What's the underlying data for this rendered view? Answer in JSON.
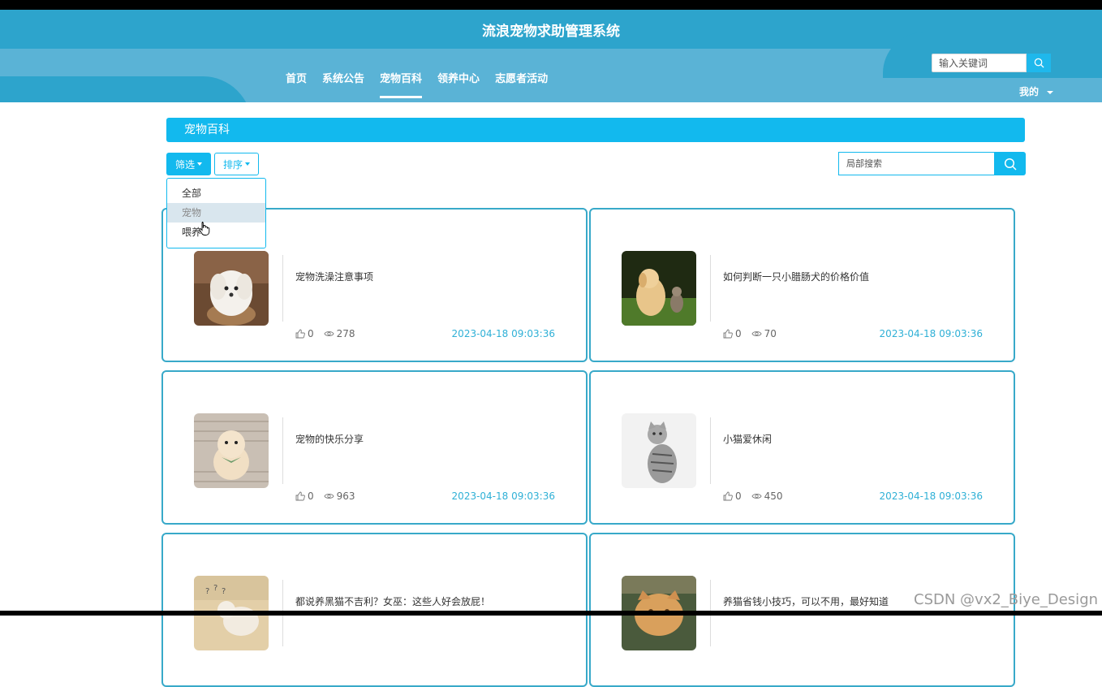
{
  "site": {
    "title": "流浪宠物求助管理系统"
  },
  "nav": {
    "items": [
      {
        "label": "首页",
        "active": false
      },
      {
        "label": "系统公告",
        "active": false
      },
      {
        "label": "宠物百科",
        "active": true
      },
      {
        "label": "领养中心",
        "active": false
      },
      {
        "label": "志愿者活动",
        "active": false
      }
    ]
  },
  "header_search": {
    "placeholder": "输入关键词"
  },
  "user_menu": {
    "label": "我的"
  },
  "section": {
    "title": "宠物百科"
  },
  "toolbar": {
    "filter_label": "筛选",
    "sort_label": "排序"
  },
  "filter_dropdown": {
    "options": [
      "全部",
      "宠物",
      "喂养"
    ],
    "hovered_index": 1
  },
  "local_search": {
    "placeholder": "局部搜索"
  },
  "articles": [
    {
      "title": "宠物洗澡注意事项",
      "likes": "0",
      "views": "278",
      "date": "2023-04-18 09:03:36",
      "image": "white-puppy-photo"
    },
    {
      "title": "如何判断一只小腊肠犬的价格价值",
      "likes": "0",
      "views": "70",
      "date": "2023-04-18 09:03:36",
      "image": "puppy-and-kitten-photo"
    },
    {
      "title": "宠物的快乐分享",
      "likes": "0",
      "views": "963",
      "date": "2023-04-18 09:03:36",
      "image": "pomeranian-photo"
    },
    {
      "title": "小猫爱休闲",
      "likes": "0",
      "views": "450",
      "date": "2023-04-18 09:03:36",
      "image": "tabby-cat-photo"
    },
    {
      "title": "都说养黑猫不吉利？女巫：这些人好会放屁！",
      "likes": "",
      "views": "",
      "date": "",
      "image": "cat-photo"
    },
    {
      "title": "养猫省钱小技巧，可以不用，最好知道",
      "likes": "",
      "views": "",
      "date": "",
      "image": "orange-cat-photo"
    }
  ],
  "watermark": {
    "text": "CSDN @vx2_Biye_Design"
  },
  "colors": {
    "header": "#2da4cc",
    "accent": "#12b9ee",
    "card_border": "#38a9c9",
    "date": "#2fb0d6"
  }
}
